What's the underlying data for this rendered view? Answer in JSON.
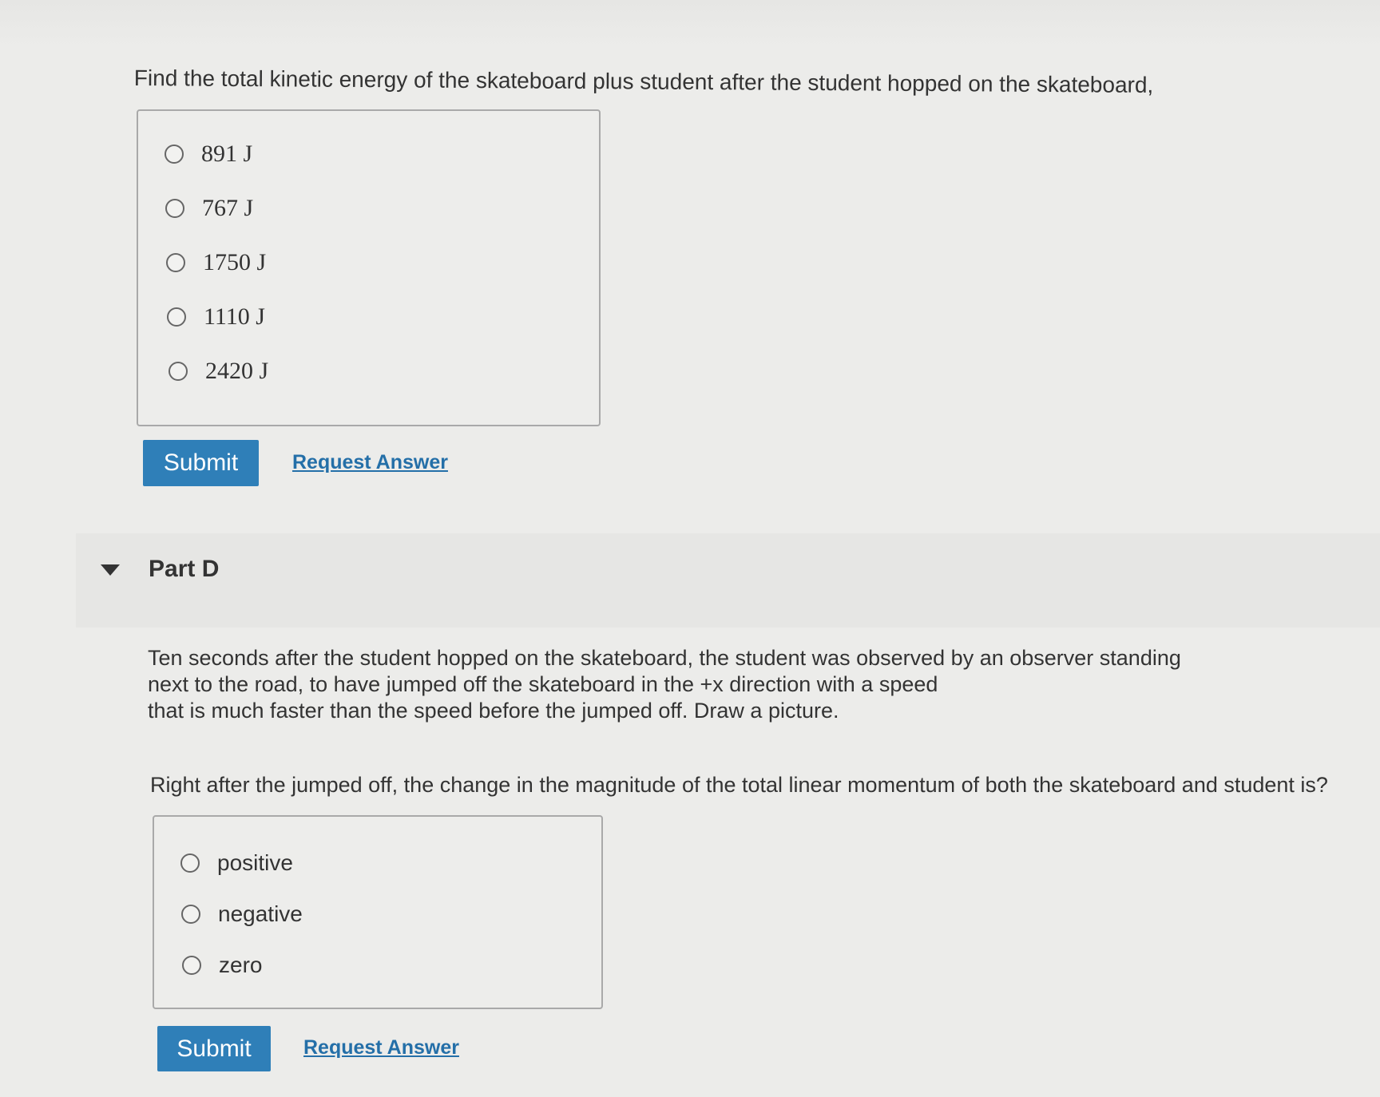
{
  "question_c": {
    "prompt": "Find the total kinetic energy of the skateboard plus student after the student hopped on the skateboard,",
    "options": [
      "891 J",
      "767 J",
      "1750 J",
      "1110 J",
      "2420 J"
    ],
    "submit_label": "Submit",
    "request_answer_label": "Request Answer"
  },
  "part_d": {
    "title": "Part D",
    "description_lines": [
      "Ten seconds after the student hopped on the skateboard, the student was observed by an observer standing",
      "next to the road, to have jumped off the skateboard in the +x direction with a speed",
      "that is much faster than the speed before the jumped off. Draw a picture."
    ],
    "question": "Right after the jumped off, the change in the magnitude of the total linear momentum of both the skateboard and student is?",
    "options": [
      "positive",
      "negative",
      "zero"
    ],
    "submit_label": "Submit",
    "request_answer_label": "Request Answer"
  },
  "icons": {
    "collapse": "caret-down-icon",
    "radio": "radio-unselected-icon"
  },
  "colors": {
    "submit_button": "#2f7fb8",
    "link": "#246fa8",
    "background": "#ececea"
  }
}
